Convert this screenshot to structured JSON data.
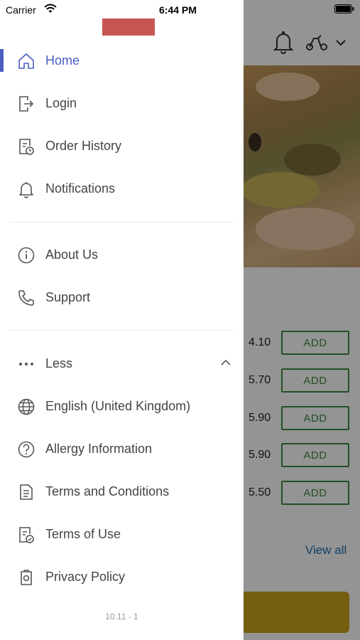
{
  "status_bar": {
    "carrier": "Carrier",
    "time": "6:44 PM"
  },
  "background": {
    "prices": [
      "4.10",
      "5.70",
      "5.90",
      "5.90",
      "5.50"
    ],
    "add_label": "ADD",
    "view_all": "View all"
  },
  "drawer": {
    "main_items": [
      {
        "label": "Home",
        "icon": "home-icon",
        "active": true
      },
      {
        "label": "Login",
        "icon": "login-icon"
      },
      {
        "label": "Order History",
        "icon": "order-history-icon"
      },
      {
        "label": "Notifications",
        "icon": "bell-icon"
      }
    ],
    "info_items": [
      {
        "label": "About Us",
        "icon": "info-icon"
      },
      {
        "label": "Support",
        "icon": "phone-icon"
      }
    ],
    "more_toggle": {
      "label": "Less",
      "icon": "more-dots-icon"
    },
    "more_items": [
      {
        "label": "English (United Kingdom)",
        "icon": "globe-icon"
      },
      {
        "label": "Allergy Information",
        "icon": "question-icon"
      },
      {
        "label": "Terms and Conditions",
        "icon": "document-icon"
      },
      {
        "label": "Terms of Use",
        "icon": "document-check-icon"
      },
      {
        "label": "Privacy Policy",
        "icon": "privacy-icon"
      }
    ],
    "version": "10.11 - 1"
  },
  "colors": {
    "accent": "#4a5fc1",
    "logo": "#c85650",
    "add_green": "#3a8a3f",
    "link_blue": "#1f6fb5"
  }
}
